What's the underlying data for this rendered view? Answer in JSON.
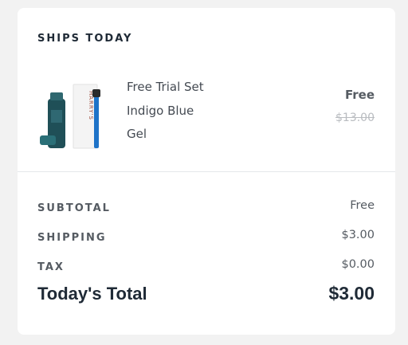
{
  "order": {
    "section_title": "SHIPS TODAY",
    "item": {
      "image_icon": "product-trial-set-image",
      "image_brand_text": "HARRY'S",
      "lines": [
        "Free Trial Set",
        "Indigo Blue",
        "Gel"
      ],
      "price": "Free",
      "original_price": "$13.00"
    }
  },
  "summary": {
    "subtotal_label": "SUBTOTAL",
    "subtotal_value": "Free",
    "shipping_label": "SHIPPING",
    "shipping_value": "$3.00",
    "tax_label": "TAX",
    "tax_value": "$0.00",
    "total_label": "Today's Total",
    "total_value": "$3.00"
  },
  "colors": {
    "heading": "#1f2a36",
    "text": "#555b62",
    "strike": "#b9bcc0",
    "razor_blue": "#1e73c8",
    "bottle_teal": "#1f4f57"
  }
}
